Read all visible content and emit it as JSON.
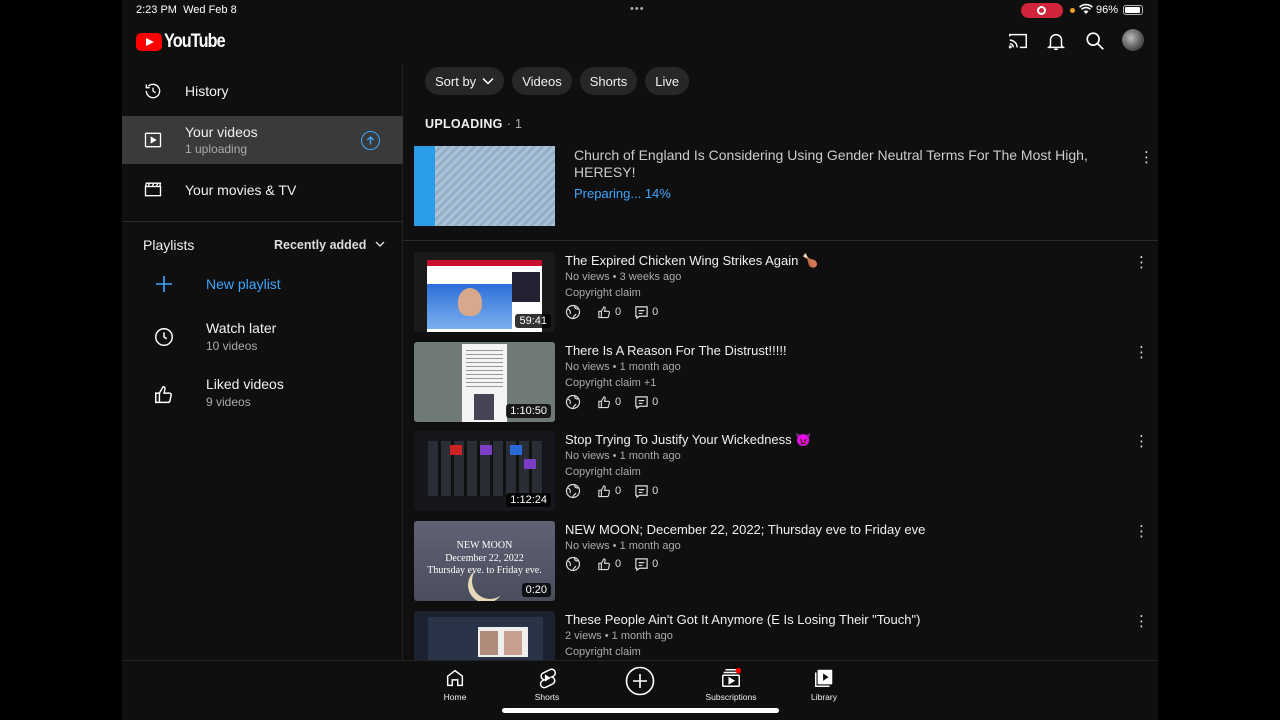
{
  "status_bar": {
    "time": "2:23 PM",
    "date": "Wed Feb 8",
    "battery": "96%",
    "recording_color": "#d0243b"
  },
  "header": {
    "logo_text": "YouTube",
    "icons": [
      "cast-icon",
      "bell-icon",
      "search-icon",
      "avatar"
    ]
  },
  "sidebar": {
    "items": [
      {
        "label": "History",
        "icon": "history-icon"
      },
      {
        "label": "Your videos",
        "sub": "1 uploading",
        "icon": "play-box-icon",
        "active": true
      },
      {
        "label": "Your movies & TV",
        "icon": "clapperboard-icon"
      }
    ],
    "playlists": {
      "heading": "Playlists",
      "sort_label": "Recently added",
      "new_playlist": "New playlist",
      "items": [
        {
          "label": "Watch later",
          "sub": "10 videos",
          "icon": "clock-icon"
        },
        {
          "label": "Liked videos",
          "sub": "9 videos",
          "icon": "thumbs-up-icon"
        }
      ]
    }
  },
  "chips": [
    "Sort by",
    "Videos",
    "Shorts",
    "Live"
  ],
  "uploading": {
    "label": "UPLOADING",
    "count": "· 1",
    "title": "Church of England Is Considering Using Gender Neutral Terms For The Most High, HERESY!",
    "status": "Preparing... 14%"
  },
  "videos": [
    {
      "title": "The Expired Chicken Wing Strikes Again 🍗",
      "views": "No views",
      "age": "3 weeks ago",
      "claim": "Copyright claim",
      "likes": "0",
      "comments": "0",
      "duration": "59:41"
    },
    {
      "title": "There Is A Reason For The Distrust!!!!!",
      "views": "No views",
      "age": "1 month ago",
      "claim": "Copyright claim +1",
      "likes": "0",
      "comments": "0",
      "duration": "1:10:50"
    },
    {
      "title": "Stop Trying To Justify Your Wickedness 👿",
      "views": "No views",
      "age": "1 month ago",
      "claim": "Copyright claim",
      "likes": "0",
      "comments": "0",
      "duration": "1:12:24"
    },
    {
      "title": "NEW MOON; December 22, 2022; Thursday eve to Friday eve",
      "views": "No views",
      "age": "1 month ago",
      "claim": "",
      "likes": "0",
      "comments": "0",
      "duration": "0:20",
      "thumb_text": [
        "NEW MOON",
        "December 22, 2022",
        "Thursday eve. to Friday eve."
      ]
    },
    {
      "title": "These People Ain't Got It Anymore (E Is Losing Their \"Touch\")",
      "views": "2 views",
      "age": "1 month ago",
      "claim": "Copyright claim",
      "likes": "",
      "comments": "",
      "duration": ""
    }
  ],
  "bottom_nav": [
    "Home",
    "Shorts",
    "Create",
    "Subscriptions",
    "Library"
  ],
  "colors": {
    "accent": "#3ea6ff",
    "brand_red": "#ff0000",
    "background": "#0f0f0f",
    "active_item": "#3a3a3a"
  }
}
